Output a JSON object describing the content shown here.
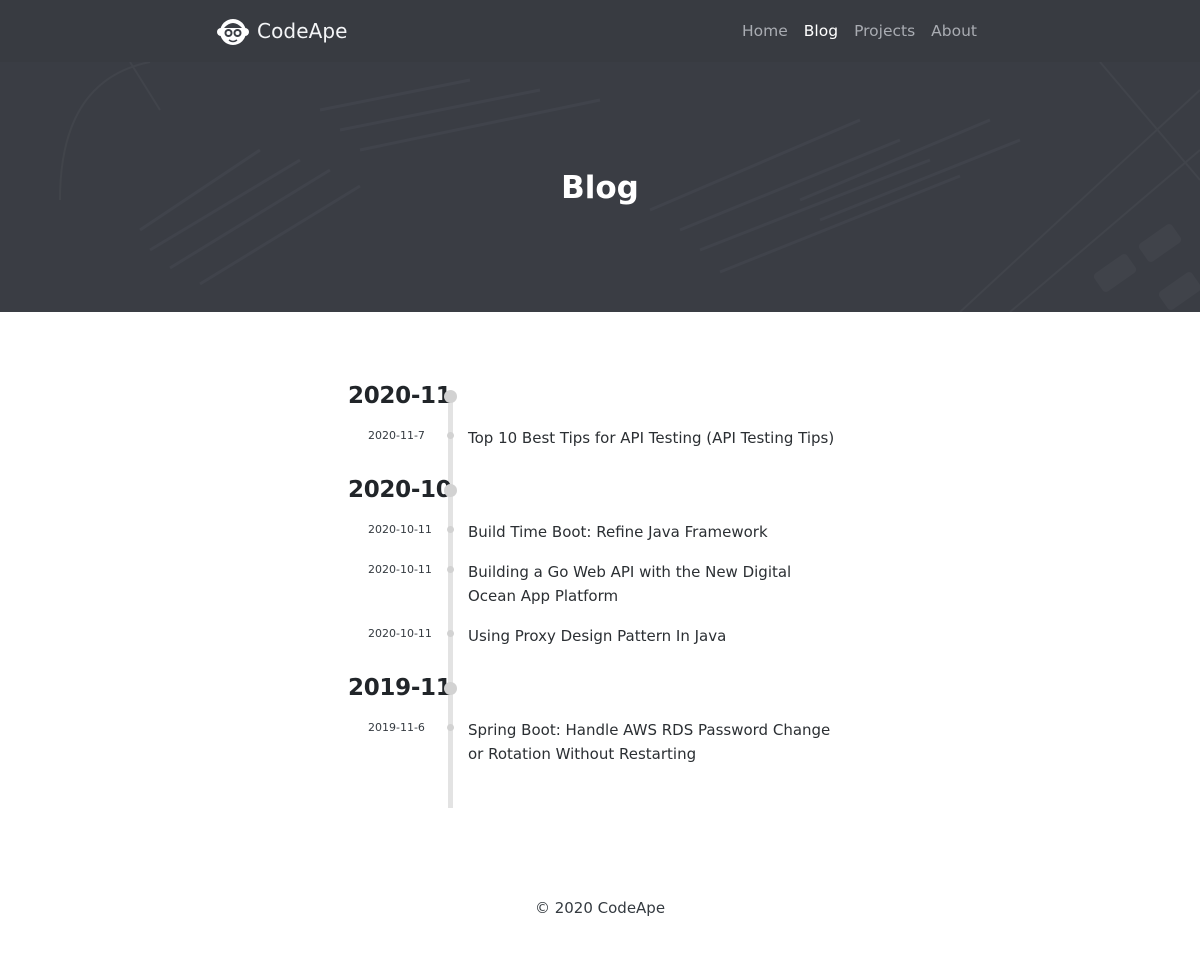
{
  "brand": {
    "name": "CodeApe"
  },
  "nav": {
    "items": [
      {
        "label": "Home",
        "active": false
      },
      {
        "label": "Blog",
        "active": true
      },
      {
        "label": "Projects",
        "active": false
      },
      {
        "label": "About",
        "active": false
      }
    ]
  },
  "hero": {
    "title": "Blog"
  },
  "archive": {
    "groups": [
      {
        "month": "2020-11",
        "posts": [
          {
            "date": "2020-11-7",
            "title": "Top 10 Best Tips for API Testing (API Testing Tips)"
          }
        ]
      },
      {
        "month": "2020-10",
        "posts": [
          {
            "date": "2020-10-11",
            "title": "Build Time Boot: Refine Java Framework"
          },
          {
            "date": "2020-10-11",
            "title": "Building a Go Web API with the New Digital Ocean App Platform"
          },
          {
            "date": "2020-10-11",
            "title": "Using Proxy Design Pattern In Java"
          }
        ]
      },
      {
        "month": "2019-11",
        "posts": [
          {
            "date": "2019-11-6",
            "title": "Spring Boot: Handle AWS RDS Password Change or Rotation Without Restarting"
          }
        ]
      }
    ]
  },
  "footer": {
    "copyright": "© 2020 CodeApe"
  },
  "colors": {
    "header_bg": "#3a3d44",
    "timeline_line": "#e3e3e3",
    "timeline_dot": "#d2d2d2"
  }
}
